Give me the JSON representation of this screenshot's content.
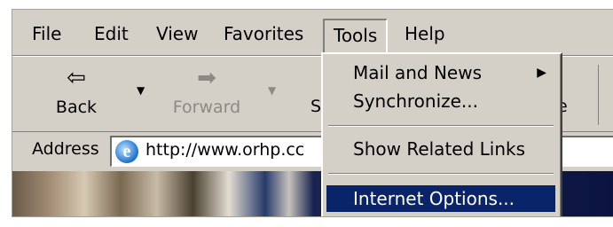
{
  "menubar": {
    "items": [
      "File",
      "Edit",
      "View",
      "Favorites",
      "Tools",
      "Help"
    ]
  },
  "toolbar": {
    "back_label": "Back",
    "forward_label": "Forward",
    "stop_partial": "S",
    "home_partial": "e"
  },
  "address": {
    "label": "Address",
    "url": "http://www.orhp.cc"
  },
  "tools_menu": {
    "items": [
      "Mail and News",
      "Synchronize...",
      "Show Related Links",
      "Internet Options..."
    ],
    "selected": "Internet Options..."
  },
  "colors": {
    "chrome": "#d4d0c8",
    "selection": "#0a246a"
  },
  "icons": {
    "back": "back-arrow-icon",
    "forward": "forward-arrow-icon",
    "ie": "internet-explorer-icon",
    "submenu": "submenu-arrow-icon"
  }
}
